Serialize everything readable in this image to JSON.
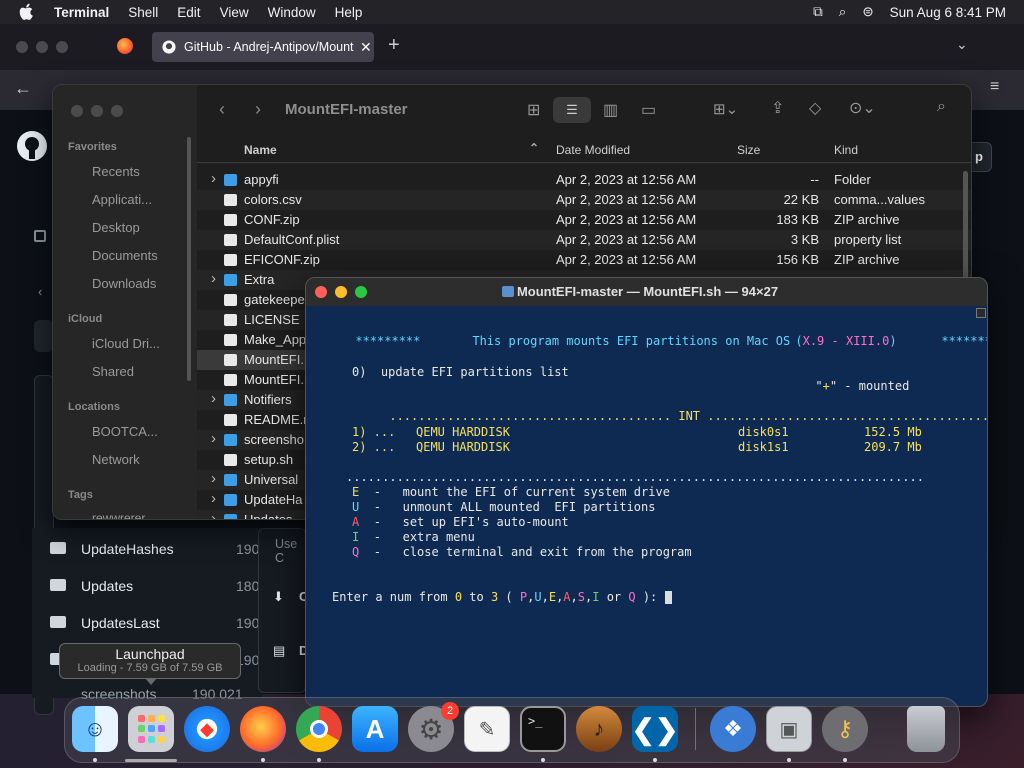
{
  "menubar": {
    "app": "Terminal",
    "items": [
      "Shell",
      "Edit",
      "View",
      "Window",
      "Help"
    ],
    "clock": "Sun Aug 6  8:41 PM"
  },
  "firefox": {
    "tab_title": "GitHub - Andrej-Antipov/Mount"
  },
  "github": {
    "list": [
      {
        "name": "UpdateHashes",
        "meta": "190"
      },
      {
        "name": "Updates",
        "meta": "180"
      },
      {
        "name": "UpdatesLast",
        "meta": "190"
      },
      {
        "name": "screenshots",
        "meta": "190 021"
      }
    ],
    "popup_items": [
      "Use C",
      "C",
      "D"
    ]
  },
  "finder": {
    "title": "MountEFI-master",
    "sidebar": {
      "favorites_label": "Favorites",
      "favorites": [
        "Recents",
        "Applicati...",
        "Desktop",
        "Documents",
        "Downloads"
      ],
      "icloud_label": "iCloud",
      "icloud": [
        "iCloud Dri...",
        "Shared"
      ],
      "locations_label": "Locations",
      "locations": [
        "BOOTCA...",
        "Network"
      ],
      "tags_label": "Tags",
      "tags": [
        "rewwrerer"
      ]
    },
    "columns": {
      "name": "Name",
      "date": "Date Modified",
      "size": "Size",
      "kind": "Kind"
    },
    "rows": [
      {
        "name": "appyfi",
        "date": "Apr 2, 2023 at 12:56 AM",
        "size": "--",
        "kind": "Folder",
        "folder": true
      },
      {
        "name": "colors.csv",
        "date": "Apr 2, 2023 at 12:56 AM",
        "size": "22 KB",
        "kind": "comma...values",
        "folder": false
      },
      {
        "name": "CONF.zip",
        "date": "Apr 2, 2023 at 12:56 AM",
        "size": "183 KB",
        "kind": "ZIP archive",
        "folder": false
      },
      {
        "name": "DefaultConf.plist",
        "date": "Apr 2, 2023 at 12:56 AM",
        "size": "3 KB",
        "kind": "property list",
        "folder": false
      },
      {
        "name": "EFICONF.zip",
        "date": "Apr 2, 2023 at 12:56 AM",
        "size": "156 KB",
        "kind": "ZIP archive",
        "folder": false
      },
      {
        "name": "Extra",
        "date": "",
        "size": "",
        "kind": "",
        "folder": true
      },
      {
        "name": "gatekeepe",
        "date": "",
        "size": "",
        "kind": "",
        "folder": false
      },
      {
        "name": "LICENSE",
        "date": "",
        "size": "",
        "kind": "",
        "folder": false
      },
      {
        "name": "Make_App",
        "date": "",
        "size": "",
        "kind": "",
        "folder": false
      },
      {
        "name": "MountEFI.",
        "date": "",
        "size": "",
        "kind": "",
        "folder": false
      },
      {
        "name": "MountEFI.",
        "date": "",
        "size": "",
        "kind": "",
        "folder": false
      },
      {
        "name": "Notifiers",
        "date": "",
        "size": "",
        "kind": "",
        "folder": true
      },
      {
        "name": "README.m",
        "date": "",
        "size": "",
        "kind": "",
        "folder": false
      },
      {
        "name": "screensho",
        "date": "",
        "size": "",
        "kind": "",
        "folder": true
      },
      {
        "name": "setup.sh",
        "date": "",
        "size": "",
        "kind": "",
        "folder": false
      },
      {
        "name": "Universal",
        "date": "",
        "size": "",
        "kind": "",
        "folder": true
      },
      {
        "name": "UpdateHa",
        "date": "",
        "size": "",
        "kind": "",
        "folder": true
      },
      {
        "name": "Updates",
        "date": "",
        "size": "",
        "kind": "",
        "folder": true
      }
    ]
  },
  "terminal": {
    "title": "MountEFI-master — MountEFI.sh — 94×27",
    "banner_stars": "*********",
    "banner_text": "This program mounts EFI partitions on Mac OS",
    "banner_version_open": "(",
    "banner_version_a": "X.9",
    "banner_version_dash": "-",
    "banner_version_b": "XIII.0",
    "banner_version_close": ")",
    "opt0": "0)  update EFI partitions list",
    "mounted_legend_open": "\"",
    "mounted_legend_plus": "+",
    "mounted_legend_rest": "\" - mounted",
    "int_rule_left": ".......................................",
    "int_label": "INT",
    "int_rule_right": ".......................................",
    "disks": [
      {
        "num": "1) ...",
        "name": "QEMU HARDDISK",
        "dev": "disk0s1",
        "size": "152.5 Mb"
      },
      {
        "num": "2) ...",
        "name": "QEMU HARDDISK",
        "dev": "disk1s1",
        "size": "209.7 Mb"
      }
    ],
    "rule": "................................................................................",
    "menu": [
      {
        "key": "E",
        "text": "mount the EFI of current system drive"
      },
      {
        "key": "U",
        "text": "unmount ALL mounted  EFI partitions"
      },
      {
        "key": "A",
        "text": "set up EFI's auto-mount"
      },
      {
        "key": "I",
        "text": "extra menu"
      },
      {
        "key": "Q",
        "text": "close terminal and exit from the program"
      }
    ],
    "key_sep": "-",
    "prompt": {
      "p1": "Enter a num from ",
      "from": "0",
      "p2": " to ",
      "to": "3",
      "p3": " ( ",
      "k1": "P",
      "c1": ",",
      "k2": "U",
      "c2": ",",
      "k3": "E",
      "c3": ",",
      "k4": "A",
      "c4": ",",
      "k5": "S",
      "c5": ",",
      "k6": "I",
      "p4": " or ",
      "k7": "Q",
      "p5": " ): "
    }
  },
  "tooltip": {
    "title": "Launchpad",
    "sub": "Loading - 7.59 GB of 7.59 GB"
  },
  "dock": {
    "badge_settings": "2"
  },
  "colors": {
    "terminal_bg": "#0f2a52",
    "accent_yellow": "#f5e05a",
    "accent_cyan": "#5fd7ff",
    "accent_magenta": "#ff6ec7"
  }
}
